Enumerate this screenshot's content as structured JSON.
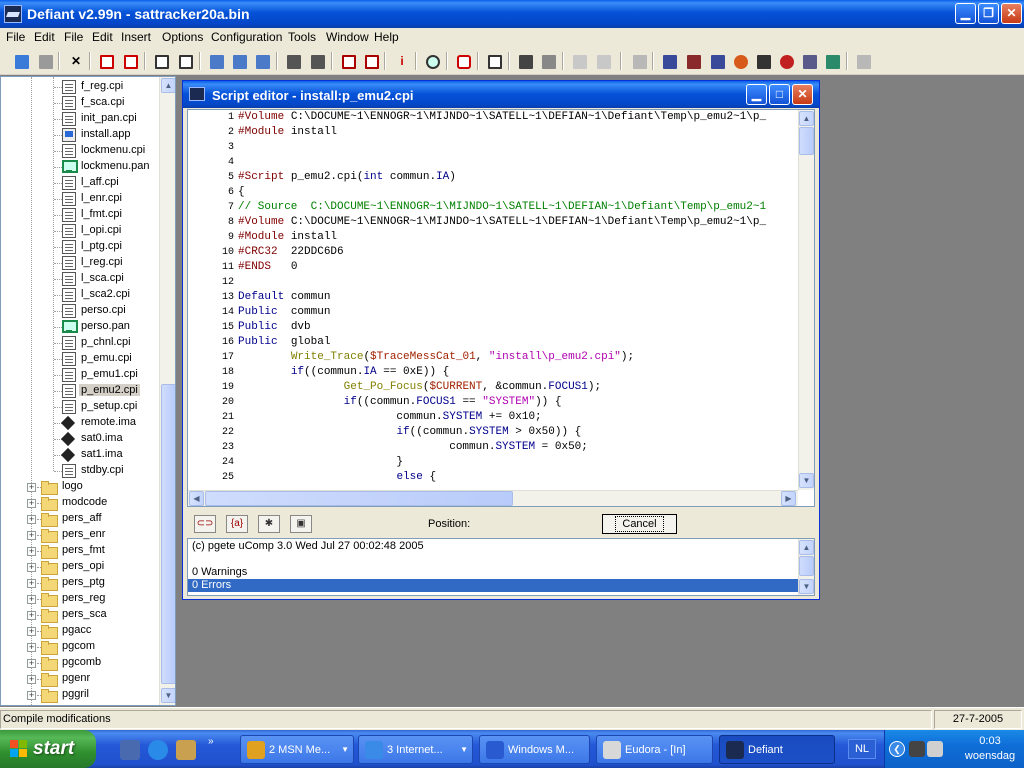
{
  "window": {
    "title": "Defiant v2.99n - sattracker20a.bin"
  },
  "menu": [
    "File",
    "Edit",
    "File",
    "Edit",
    "Insert",
    "Options",
    "Configuration",
    "Tools",
    "Window",
    "Help"
  ],
  "tree": {
    "files": [
      {
        "name": "f_reg.cpi",
        "icon": "file-icon"
      },
      {
        "name": "f_sca.cpi",
        "icon": "file-icon"
      },
      {
        "name": "init_pan.cpi",
        "icon": "file-icon"
      },
      {
        "name": "install.app",
        "icon": "app-file-icon"
      },
      {
        "name": "lockmenu.cpi",
        "icon": "file-icon"
      },
      {
        "name": "lockmenu.pan",
        "icon": "panel-file-icon"
      },
      {
        "name": "l_aff.cpi",
        "icon": "file-icon"
      },
      {
        "name": "l_enr.cpi",
        "icon": "file-icon"
      },
      {
        "name": "l_fmt.cpi",
        "icon": "file-icon"
      },
      {
        "name": "l_opi.cpi",
        "icon": "file-icon"
      },
      {
        "name": "l_ptg.cpi",
        "icon": "file-icon"
      },
      {
        "name": "l_reg.cpi",
        "icon": "file-icon"
      },
      {
        "name": "l_sca.cpi",
        "icon": "file-icon"
      },
      {
        "name": "l_sca2.cpi",
        "icon": "file-icon"
      },
      {
        "name": "perso.cpi",
        "icon": "file-icon"
      },
      {
        "name": "perso.pan",
        "icon": "panel-file-icon"
      },
      {
        "name": "p_chnl.cpi",
        "icon": "file-icon"
      },
      {
        "name": "p_emu.cpi",
        "icon": "file-icon"
      },
      {
        "name": "p_emu1.cpi",
        "icon": "file-icon"
      },
      {
        "name": "p_emu2.cpi",
        "icon": "file-icon",
        "selected": true
      },
      {
        "name": "p_setup.cpi",
        "icon": "file-icon"
      },
      {
        "name": "remote.ima",
        "icon": "image-file-icon"
      },
      {
        "name": "sat0.ima",
        "icon": "image-file-icon"
      },
      {
        "name": "sat1.ima",
        "icon": "image-file-icon"
      },
      {
        "name": "stdby.cpi",
        "icon": "file-icon"
      }
    ],
    "folders": [
      "logo",
      "modcode",
      "pers_aff",
      "pers_enr",
      "pers_fmt",
      "pers_opi",
      "pers_ptg",
      "pers_reg",
      "pers_sca",
      "pgacc",
      "pgcom",
      "pgcomb",
      "pgenr",
      "pggril"
    ]
  },
  "editor": {
    "title": "Script editor - install:p_emu2.cpi",
    "line_numbers": [
      "1",
      "2",
      "3",
      "4",
      "5",
      "6",
      "7",
      "8",
      "9",
      "10",
      "11",
      "12",
      "13",
      "14",
      "15",
      "16",
      "17",
      "18",
      "19",
      "20",
      "21",
      "22",
      "23",
      "24",
      "25"
    ],
    "code": [
      [
        {
          "t": "#Volume ",
          "c": "dir"
        },
        {
          "t": "C:\\DOCUME~1\\ENNOGR~1\\MIJNDO~1\\SATELL~1\\DEFIAN~1\\Defiant\\Temp\\p_emu2~1\\p_",
          "c": ""
        }
      ],
      [
        {
          "t": "#Module ",
          "c": "dir"
        },
        {
          "t": "install",
          "c": ""
        }
      ],
      [],
      [],
      [
        {
          "t": "#Script ",
          "c": "dir"
        },
        {
          "t": "p_emu2.cpi(",
          "c": ""
        },
        {
          "t": "int",
          "c": "key"
        },
        {
          "t": " commun.",
          "c": ""
        },
        {
          "t": "IA",
          "c": "mem"
        },
        {
          "t": ")",
          "c": ""
        }
      ],
      [
        {
          "t": "{",
          "c": ""
        }
      ],
      [
        {
          "t": "// Source  C:\\DOCUME~1\\ENNOGR~1\\MIJNDO~1\\SATELL~1\\DEFIAN~1\\Defiant\\Temp\\p_emu2~1",
          "c": "com"
        }
      ],
      [
        {
          "t": "#Volume ",
          "c": "dir"
        },
        {
          "t": "C:\\DOCUME~1\\ENNOGR~1\\MIJNDO~1\\SATELL~1\\DEFIAN~1\\Defiant\\Temp\\p_emu2~1\\p_",
          "c": ""
        }
      ],
      [
        {
          "t": "#Module ",
          "c": "dir"
        },
        {
          "t": "install",
          "c": ""
        }
      ],
      [
        {
          "t": "#CRC32  ",
          "c": "dir"
        },
        {
          "t": "22DDC6D6",
          "c": ""
        }
      ],
      [
        {
          "t": "#ENDS   ",
          "c": "dir"
        },
        {
          "t": "0",
          "c": ""
        }
      ],
      [],
      [
        {
          "t": "Default ",
          "c": "key"
        },
        {
          "t": "commun",
          "c": ""
        }
      ],
      [
        {
          "t": "Public  ",
          "c": "key"
        },
        {
          "t": "commun",
          "c": ""
        }
      ],
      [
        {
          "t": "Public  ",
          "c": "key"
        },
        {
          "t": "dvb",
          "c": ""
        }
      ],
      [
        {
          "t": "Public  ",
          "c": "key"
        },
        {
          "t": "global",
          "c": ""
        }
      ],
      [
        {
          "t": "        ",
          "c": ""
        },
        {
          "t": "Write_Trace",
          "c": "fn"
        },
        {
          "t": "(",
          "c": ""
        },
        {
          "t": "$TraceMessCat_01",
          "c": "var"
        },
        {
          "t": ", ",
          "c": ""
        },
        {
          "t": "\"install\\p_emu2.cpi\"",
          "c": "str"
        },
        {
          "t": ");",
          "c": ""
        }
      ],
      [
        {
          "t": "        ",
          "c": ""
        },
        {
          "t": "if",
          "c": "key"
        },
        {
          "t": "((commun.",
          "c": ""
        },
        {
          "t": "IA",
          "c": "mem"
        },
        {
          "t": " == 0xE)) {",
          "c": ""
        }
      ],
      [
        {
          "t": "                ",
          "c": ""
        },
        {
          "t": "Get_Po_Focus",
          "c": "fn"
        },
        {
          "t": "(",
          "c": ""
        },
        {
          "t": "$CURRENT",
          "c": "var"
        },
        {
          "t": ", &commun.",
          "c": ""
        },
        {
          "t": "FOCUS1",
          "c": "mem"
        },
        {
          "t": ");",
          "c": ""
        }
      ],
      [
        {
          "t": "                ",
          "c": ""
        },
        {
          "t": "if",
          "c": "key"
        },
        {
          "t": "((commun.",
          "c": ""
        },
        {
          "t": "FOCUS1",
          "c": "mem"
        },
        {
          "t": " == ",
          "c": ""
        },
        {
          "t": "\"SYSTEM\"",
          "c": "str"
        },
        {
          "t": ")) {",
          "c": ""
        }
      ],
      [
        {
          "t": "                        commun.",
          "c": ""
        },
        {
          "t": "SYSTEM",
          "c": "mem"
        },
        {
          "t": " += 0x10;",
          "c": ""
        }
      ],
      [
        {
          "t": "                        ",
          "c": ""
        },
        {
          "t": "if",
          "c": "key"
        },
        {
          "t": "((commun.",
          "c": ""
        },
        {
          "t": "SYSTEM",
          "c": "mem"
        },
        {
          "t": " > 0x50)) {",
          "c": ""
        }
      ],
      [
        {
          "t": "                                commun.",
          "c": ""
        },
        {
          "t": "SYSTEM",
          "c": "mem"
        },
        {
          "t": " = 0x50;",
          "c": ""
        }
      ],
      [
        {
          "t": "                        }",
          "c": ""
        }
      ],
      [
        {
          "t": "                        ",
          "c": ""
        },
        {
          "t": "else",
          "c": "key"
        },
        {
          "t": " {",
          "c": ""
        }
      ]
    ],
    "position_label": "Position:",
    "cancel_label": "Cancel",
    "messages": [
      {
        "text": "(c) pgete uComp 3.0 Wed Jul 27 00:02:48 2005",
        "selected": false
      },
      {
        "text": "",
        "selected": false
      },
      {
        "text": "  0 Warnings",
        "selected": false
      },
      {
        "text": "  0 Errors",
        "selected": true
      }
    ]
  },
  "status": {
    "text": "Compile modifications",
    "date": "27-7-2005"
  },
  "taskbar": {
    "start_label": "start",
    "tasks": [
      {
        "label": "2 MSN Me...",
        "icon_color": "#e0a020",
        "has_menu": true
      },
      {
        "label": "3 Internet...",
        "icon_color": "#3a8ae8",
        "has_menu": true
      },
      {
        "label": "Windows M...",
        "icon_color": "#2a5ad0",
        "has_menu": false
      },
      {
        "label": "Eudora - [In]",
        "icon_color": "#d8d8d8",
        "has_menu": false
      },
      {
        "label": "Defiant",
        "icon_color": "#1a2a50",
        "has_menu": false,
        "active": true
      }
    ],
    "language": "NL",
    "clock_time": "0:03",
    "clock_day": "woensdag"
  },
  "colors": {
    "xp_blue": "#0552d8",
    "selection": "#316ac5",
    "window_bg": "#ece9d8"
  }
}
